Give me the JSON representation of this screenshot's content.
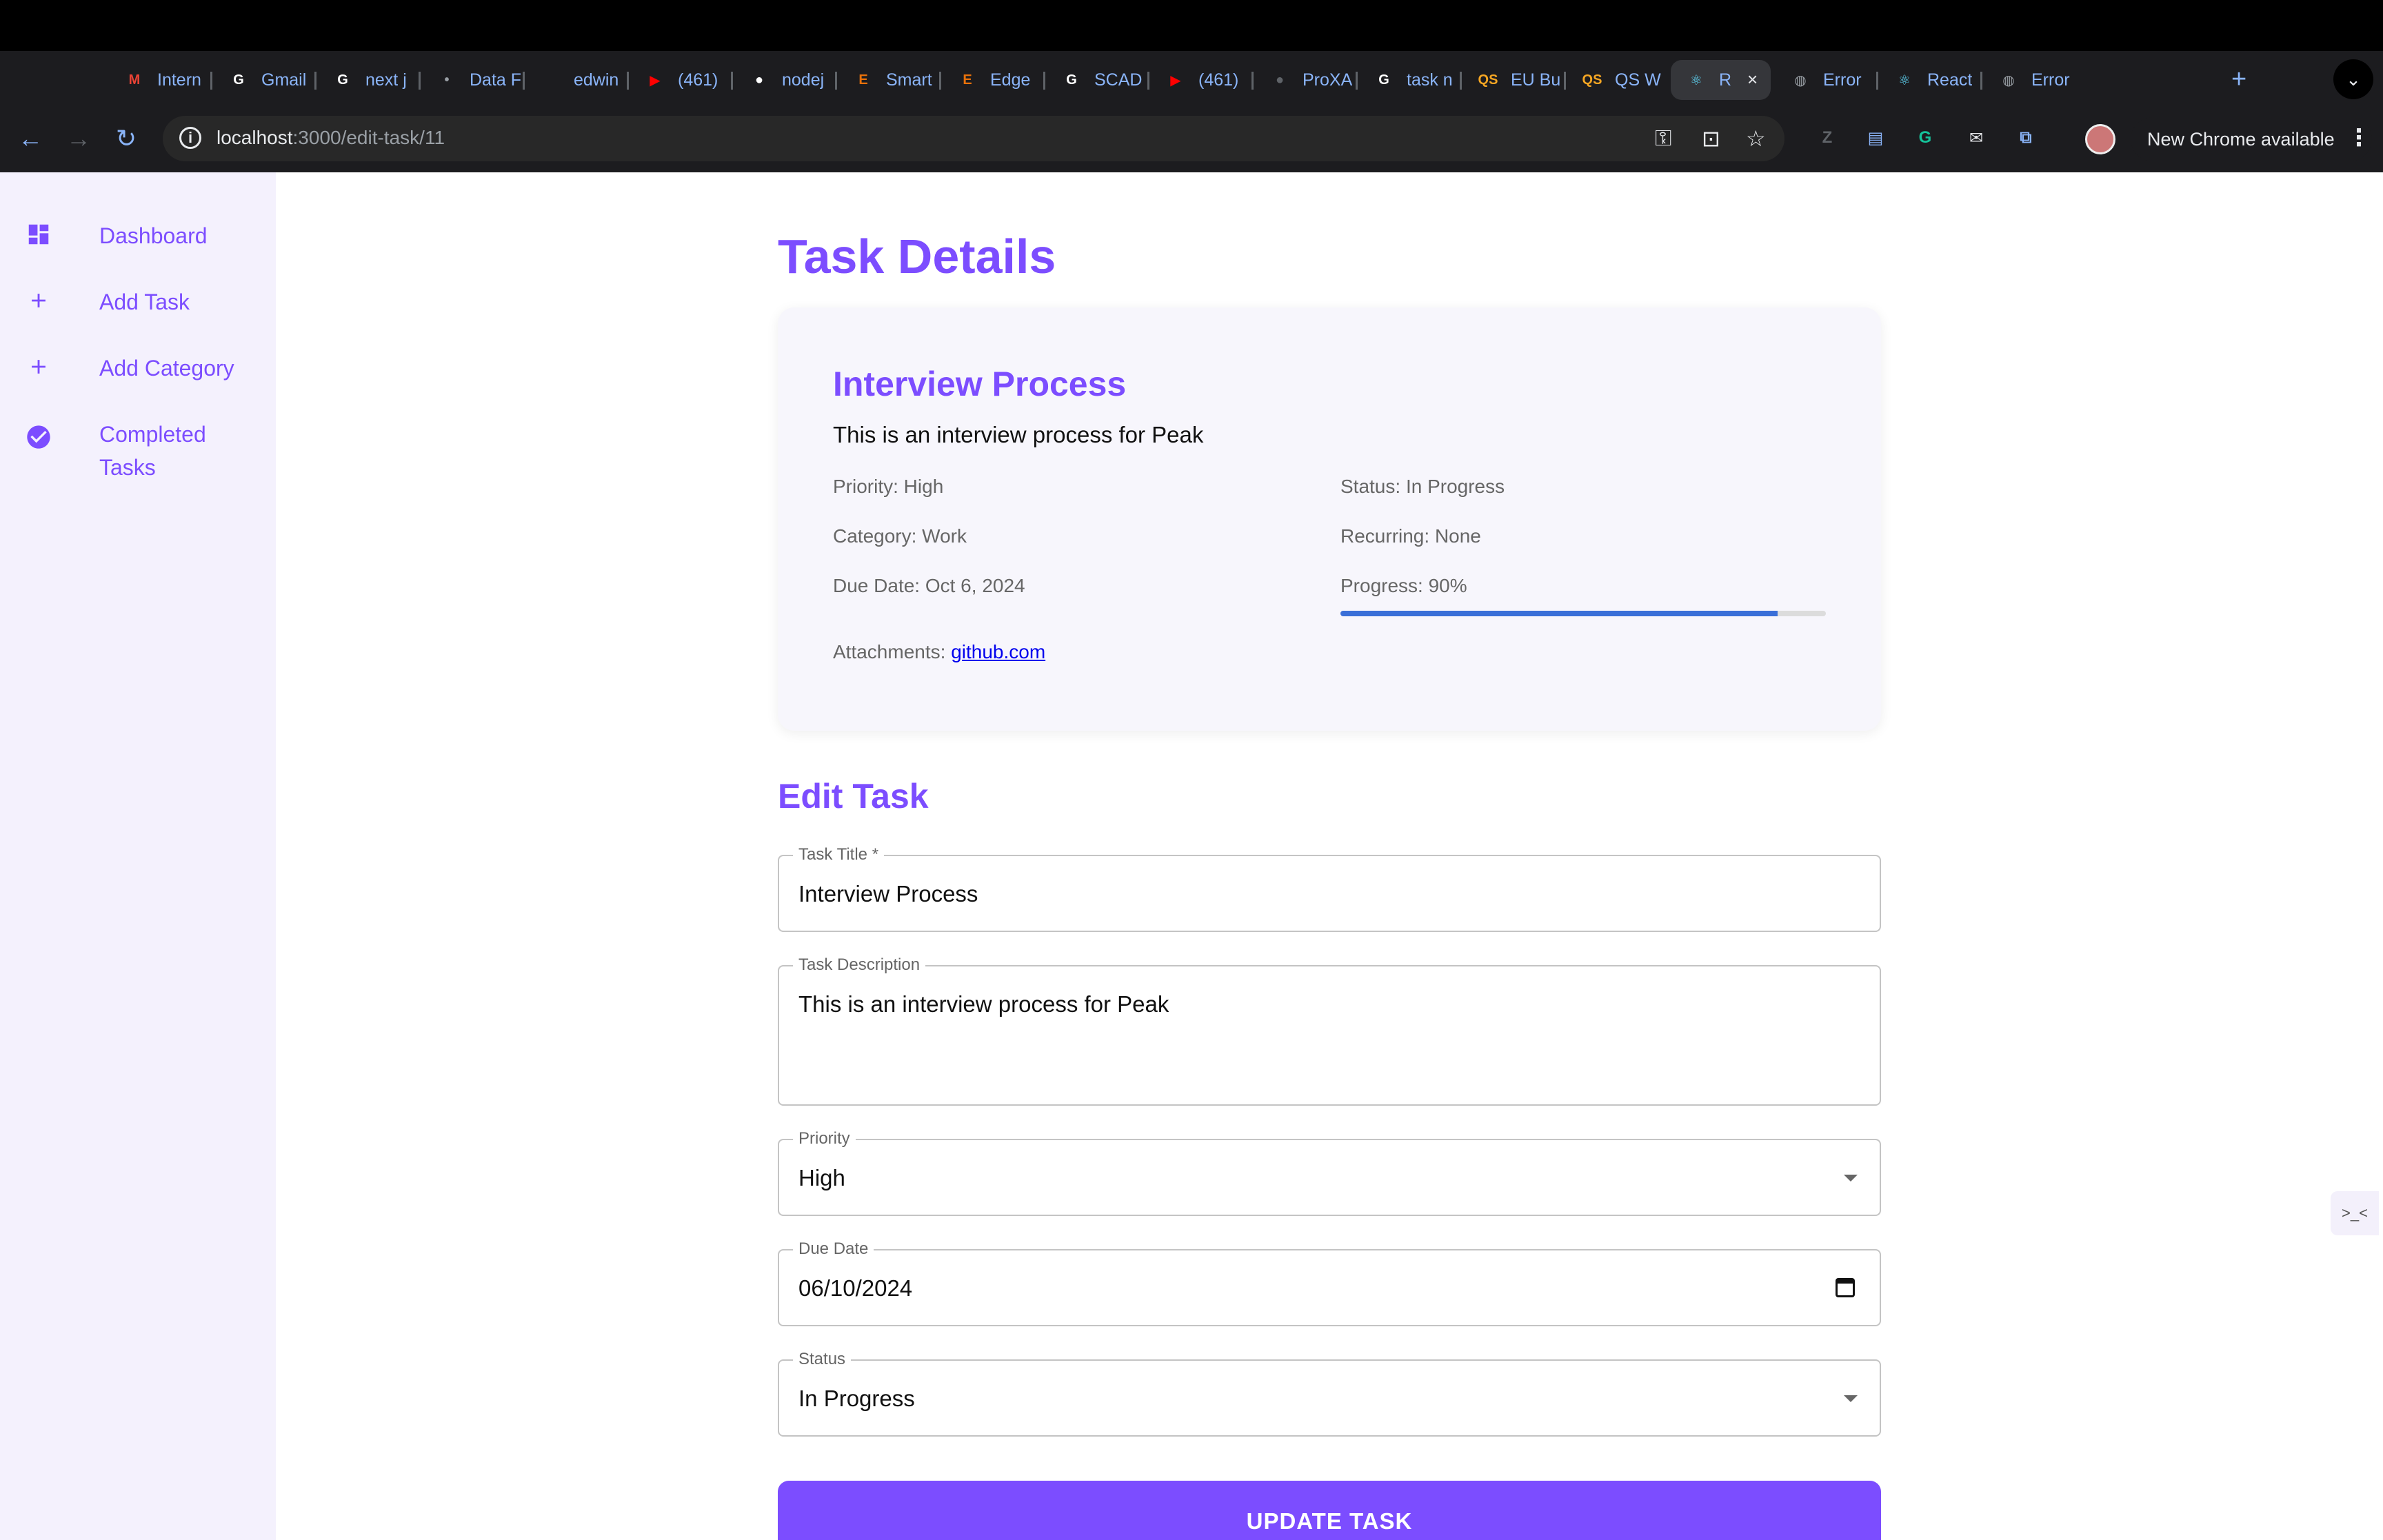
{
  "browser": {
    "tabs": [
      {
        "title": "Intern",
        "fav": "gmail-icon",
        "fav_text": "M",
        "fav_color": "#ea4335"
      },
      {
        "title": "Gmail",
        "fav": "google-icon",
        "fav_text": "G",
        "fav_color": "#ffffff"
      },
      {
        "title": "next j",
        "fav": "google-icon",
        "fav_text": "G",
        "fav_color": "#ffffff"
      },
      {
        "title": "Data F",
        "fav": "dot-icon",
        "fav_text": "•",
        "fav_color": "#9aa0a6"
      },
      {
        "title": "edwin",
        "fav": "blank-icon",
        "fav_text": "",
        "fav_color": "#1c1c1f"
      },
      {
        "title": "(461)",
        "fav": "youtube-icon",
        "fav_text": "▶",
        "fav_color": "#ff0000"
      },
      {
        "title": "nodej",
        "fav": "github-icon",
        "fav_text": "●",
        "fav_color": "#ffffff"
      },
      {
        "title": "Smart",
        "fav": "letter-e-icon",
        "fav_text": "E",
        "fav_color": "#e8710a"
      },
      {
        "title": "Edge",
        "fav": "letter-e-icon",
        "fav_text": "E",
        "fav_color": "#e8710a"
      },
      {
        "title": "SCAD",
        "fav": "google-icon",
        "fav_text": "G",
        "fav_color": "#ffffff"
      },
      {
        "title": "(461)",
        "fav": "youtube-icon",
        "fav_text": "▶",
        "fav_color": "#ff0000"
      },
      {
        "title": "ProXA",
        "fav": "github-icon",
        "fav_text": "●",
        "fav_color": "#5f6368"
      },
      {
        "title": "task n",
        "fav": "google-icon",
        "fav_text": "G",
        "fav_color": "#ffffff"
      },
      {
        "title": "EU Bu",
        "fav": "qs-icon",
        "fav_text": "QS",
        "fav_color": "#f5a623"
      },
      {
        "title": "QS W",
        "fav": "qs-icon",
        "fav_text": "QS",
        "fav_color": "#f5a623"
      },
      {
        "title": "R",
        "fav": "react-icon",
        "fav_text": "⚛",
        "fav_color": "#61dafb"
      },
      {
        "title": "Error",
        "fav": "globe-icon",
        "fav_text": "◍",
        "fav_color": "#9aa0a6"
      },
      {
        "title": "React",
        "fav": "react-icon",
        "fav_text": "⚛",
        "fav_color": "#61dafb"
      },
      {
        "title": "Error",
        "fav": "globe-icon",
        "fav_text": "◍",
        "fav_color": "#9aa0a6"
      }
    ],
    "active_tab_index": 15,
    "url_host": "localhost",
    "url_path": ":3000/edit-task/11",
    "update_label": "New Chrome available"
  },
  "sidebar": {
    "items": [
      {
        "label": "Dashboard",
        "icon": "dashboard-icon"
      },
      {
        "label": "Add Task",
        "icon": "plus-icon"
      },
      {
        "label": "Add Category",
        "icon": "plus-icon"
      },
      {
        "label": "Completed Tasks",
        "icon": "check-circle-icon"
      }
    ]
  },
  "details": {
    "page_title": "Task Details",
    "task_title": "Interview Process",
    "description": "This is an interview process for Peak",
    "priority": "Priority: High",
    "status": "Status: In Progress",
    "category": "Category: Work",
    "recurring": "Recurring: None",
    "due_date": "Due Date: Oct 6, 2024",
    "progress_label": "Progress: 90%",
    "progress_value": 0.9,
    "attachments_label": "Attachments:",
    "attachment_link": "github.com"
  },
  "form": {
    "section_title": "Edit Task",
    "title_label": "Task Title *",
    "title_value": "Interview Process",
    "description_label": "Task Description",
    "description_value": "This is an interview process for Peak",
    "priority_label": "Priority",
    "priority_value": "High",
    "due_label": "Due Date",
    "due_value": "06/10/2024",
    "status_label": "Status",
    "status_value": "In Progress",
    "submit_label": "UPDATE TASK"
  },
  "colors": {
    "accent": "#7c4dff",
    "progress": "#3a6fd8",
    "sidebar_bg": "#f4f1fd"
  }
}
